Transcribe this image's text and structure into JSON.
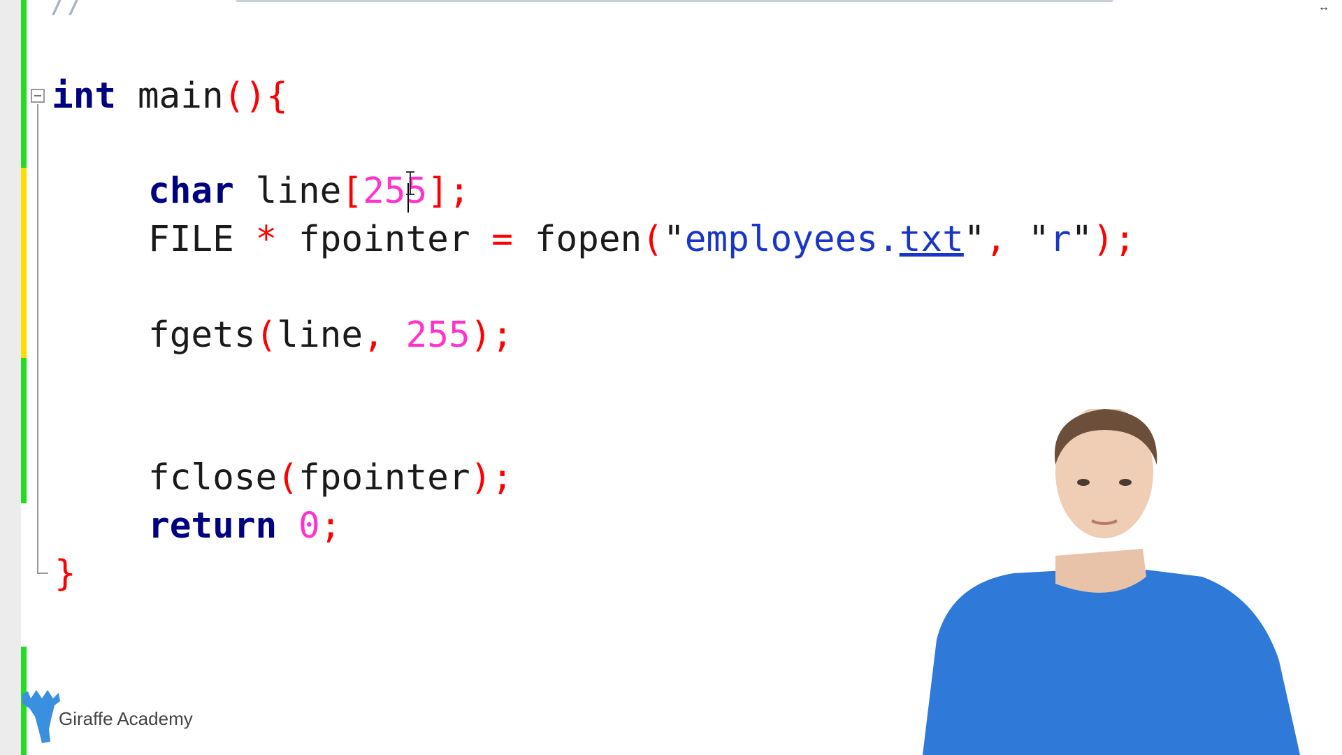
{
  "editor": {
    "comment_fragment": "//",
    "lines": {
      "l1": {
        "kw": "int",
        "name": " main",
        "paren": "()",
        "brace": "{"
      },
      "l2": {
        "kw": "char",
        "name": " line",
        "open": "[",
        "num": "255",
        "close": "]",
        "semi": ";"
      },
      "l3": {
        "type": "FILE",
        "star": " * ",
        "var": "fpointer ",
        "eq": "=",
        "fn": " fopen",
        "open": "(",
        "q1": "\"",
        "file_a": "employees.",
        "file_b": "txt",
        "q2": "\"",
        "comma": ",",
        "space": " ",
        "q3": "\"",
        "mode": "r",
        "q4": "\"",
        "close": ")",
        "semi": ";"
      },
      "l4": {
        "fn": "fgets",
        "open": "(",
        "arg": "line",
        "comma": ",",
        "num": " 255",
        "close": ")",
        "semi": ";"
      },
      "l5": {
        "fn": "fclose",
        "open": "(",
        "arg": "fpointer",
        "close": ")",
        "semi": ";"
      },
      "l6": {
        "kw": "return",
        "num": " 0",
        "semi": ";"
      },
      "l7": {
        "brace": "}"
      }
    }
  },
  "colors": {
    "keyword": "#000080",
    "operator": "#ff0000",
    "number": "#ff33cc",
    "string": "#1a36c8",
    "change_saved": "#22dd22",
    "change_unsaved": "#ffdd00"
  },
  "brand": {
    "name": "Giraffe Academy",
    "logo_icon": "giraffe-icon"
  },
  "icons": {
    "resize": "horizontal-resize-icon",
    "fold": "fold-collapse-icon"
  }
}
